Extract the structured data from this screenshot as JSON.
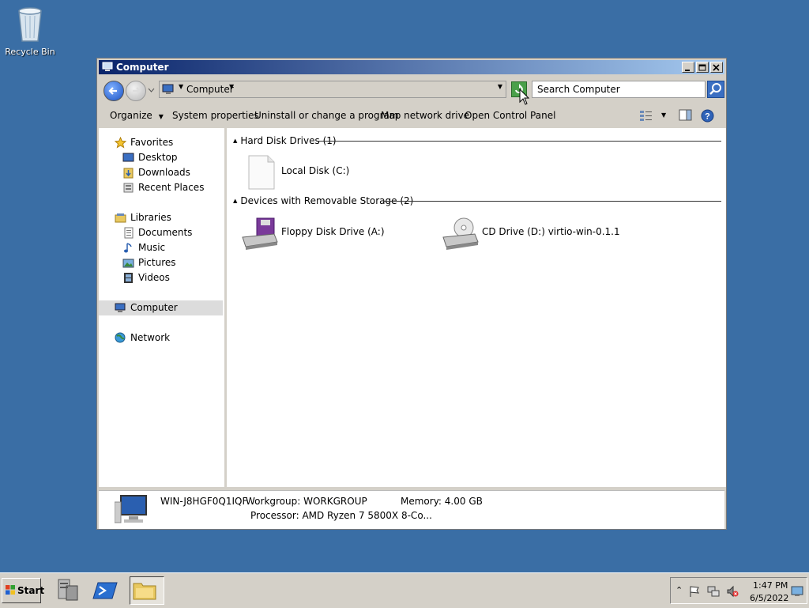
{
  "desktop": {
    "recycle_bin_label": "Recycle Bin"
  },
  "window": {
    "title": "Computer",
    "address": {
      "location": "Computer"
    },
    "search_placeholder": "Search Computer",
    "toolbar": {
      "organize": "Organize",
      "system_properties": "System properties",
      "uninstall": "Uninstall or change a program",
      "map_drive": "Map network drive",
      "control_panel": "Open Control Panel"
    },
    "nav": {
      "favorites": "Favorites",
      "desktop": "Desktop",
      "downloads": "Downloads",
      "recent_places": "Recent Places",
      "libraries": "Libraries",
      "documents": "Documents",
      "music": "Music",
      "pictures": "Pictures",
      "videos": "Videos",
      "computer": "Computer",
      "network": "Network"
    },
    "groups": {
      "hdd": {
        "title": "Hard Disk Drives (1)",
        "items": [
          "Local Disk (C:)"
        ]
      },
      "removable": {
        "title": "Devices with Removable Storage (2)",
        "items": [
          "Floppy Disk Drive (A:)",
          "CD Drive (D:) virtio-win-0.1.1"
        ]
      }
    },
    "details": {
      "computer_name": "WIN-J8HGF0Q1IQF",
      "workgroup": "Workgroup: WORKGROUP",
      "memory": "Memory: 4.00 GB",
      "processor": "Processor: AMD Ryzen 7 5800X 8-Co..."
    }
  },
  "taskbar": {
    "start_label": "Start",
    "clock_time": "1:47 PM",
    "clock_date": "6/5/2022"
  },
  "colors": {
    "desktop_bg": "#3a6ea5",
    "title_gradient_start": "#0a246a",
    "title_gradient_end": "#a6caf0",
    "chrome": "#d4d0c8"
  }
}
